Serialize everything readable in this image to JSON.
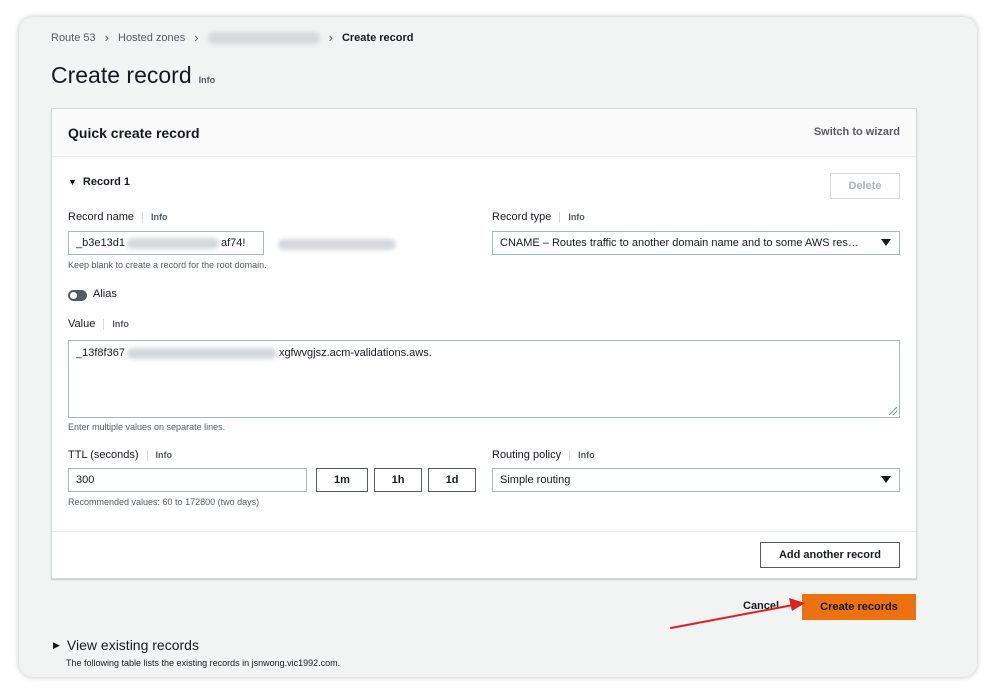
{
  "breadcrumb": {
    "items": [
      "Route 53",
      "Hosted zones"
    ],
    "current": "Create record"
  },
  "page": {
    "title": "Create record",
    "info": "Info"
  },
  "panel": {
    "title": "Quick create record",
    "switch_wizard": "Switch to wizard",
    "record_toggle": "Record 1",
    "delete": "Delete"
  },
  "form": {
    "record_name": {
      "label": "Record name",
      "info": "Info",
      "value_prefix": "_b3e13d1",
      "value_suffix": "af74!",
      "hint": "Keep blank to create a record for the root domain."
    },
    "record_type": {
      "label": "Record type",
      "info": "Info",
      "selected": "CNAME – Routes traffic to another domain name and to some AWS res…"
    },
    "alias": {
      "label": "Alias",
      "on": false
    },
    "value": {
      "label": "Value",
      "info": "Info",
      "prefix": "_13f8f367",
      "suffix": "xgfwvgjsz.acm-validations.aws.",
      "hint": "Enter multiple values on separate lines."
    },
    "ttl": {
      "label": "TTL (seconds)",
      "info": "Info",
      "value": "300",
      "presets": [
        "1m",
        "1h",
        "1d"
      ],
      "hint": "Recommended values: 60 to 172800 (two days)"
    },
    "routing_policy": {
      "label": "Routing policy",
      "info": "Info",
      "selected": "Simple routing"
    }
  },
  "footer": {
    "add_another": "Add another record",
    "cancel": "Cancel",
    "create": "Create records"
  },
  "existing": {
    "title": "View existing records",
    "description": "The following table lists the existing records in jsnwong.vic1992.com."
  },
  "colors": {
    "primary_button": "#ec7211",
    "annotation_arrow": "#e02020",
    "background": "#f2f3f3"
  }
}
